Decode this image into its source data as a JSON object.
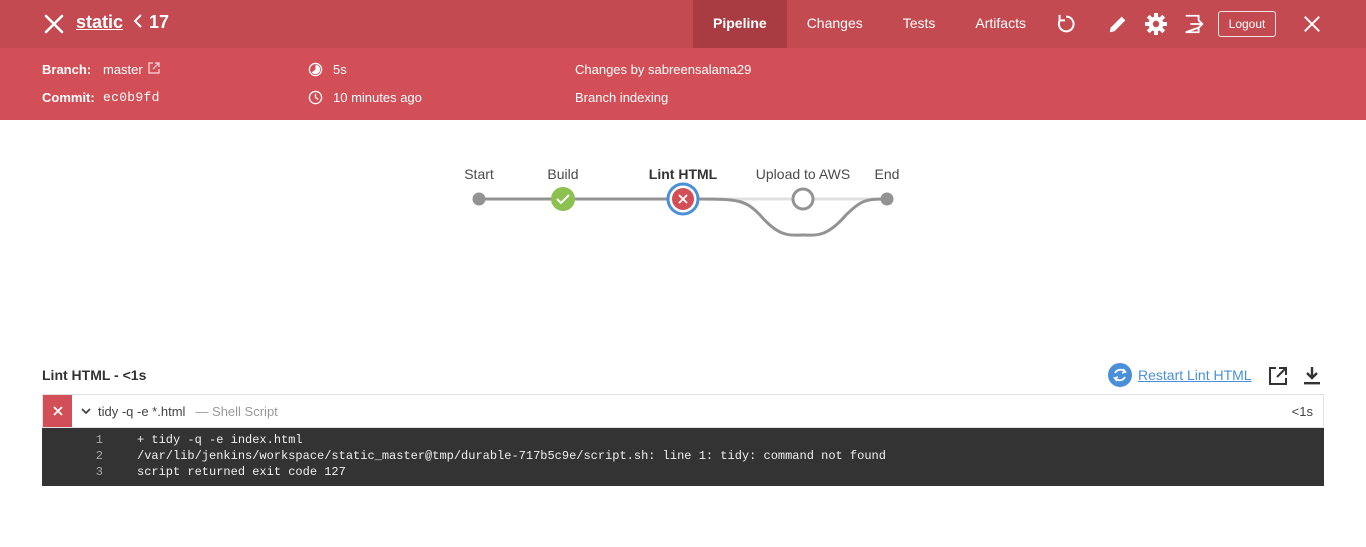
{
  "header": {
    "job_name": "static",
    "run_number": "17",
    "tabs": [
      {
        "label": "Pipeline",
        "active": true
      },
      {
        "label": "Changes",
        "active": false
      },
      {
        "label": "Tests",
        "active": false
      },
      {
        "label": "Artifacts",
        "active": false
      }
    ],
    "logout_label": "Logout",
    "icons": [
      "close-icon",
      "chevron-left-icon",
      "replay-icon",
      "edit-icon",
      "gear-icon",
      "exit-icon",
      "close-icon"
    ]
  },
  "info": {
    "branch_label": "Branch:",
    "branch_value": "master",
    "commit_label": "Commit:",
    "commit_value": "ec0b9fd",
    "duration": "5s",
    "time_ago": "10 minutes ago",
    "changes_by": "Changes by sabreensalama29",
    "cause": "Branch indexing"
  },
  "pipeline": {
    "nodes": [
      {
        "label": "Start",
        "status": "start"
      },
      {
        "label": "Build",
        "status": "success"
      },
      {
        "label": "Lint HTML",
        "status": "failed",
        "selected": true
      },
      {
        "label": "Upload to AWS",
        "status": "not-built"
      },
      {
        "label": "End",
        "status": "end"
      }
    ]
  },
  "stage": {
    "title": "Lint HTML - <1s",
    "restart_label": "Restart Lint HTML"
  },
  "step": {
    "command": "tidy -q -e *.html",
    "kind": "— Shell Script",
    "duration": "<1s"
  },
  "log": [
    {
      "num": "1",
      "text": "+ tidy -q -e index.html"
    },
    {
      "num": "2",
      "text": "/var/lib/jenkins/workspace/static_master@tmp/durable-717b5c9e/script.sh: line 1: tidy: command not found"
    },
    {
      "num": "3",
      "text": "script returned exit code 127"
    }
  ],
  "colors": {
    "topbar": "#c24a50",
    "infobar": "#d24f57",
    "success": "#8cc04f",
    "failure": "#d24f57",
    "selected_ring": "#4a90d9",
    "log_bg": "#333333"
  }
}
